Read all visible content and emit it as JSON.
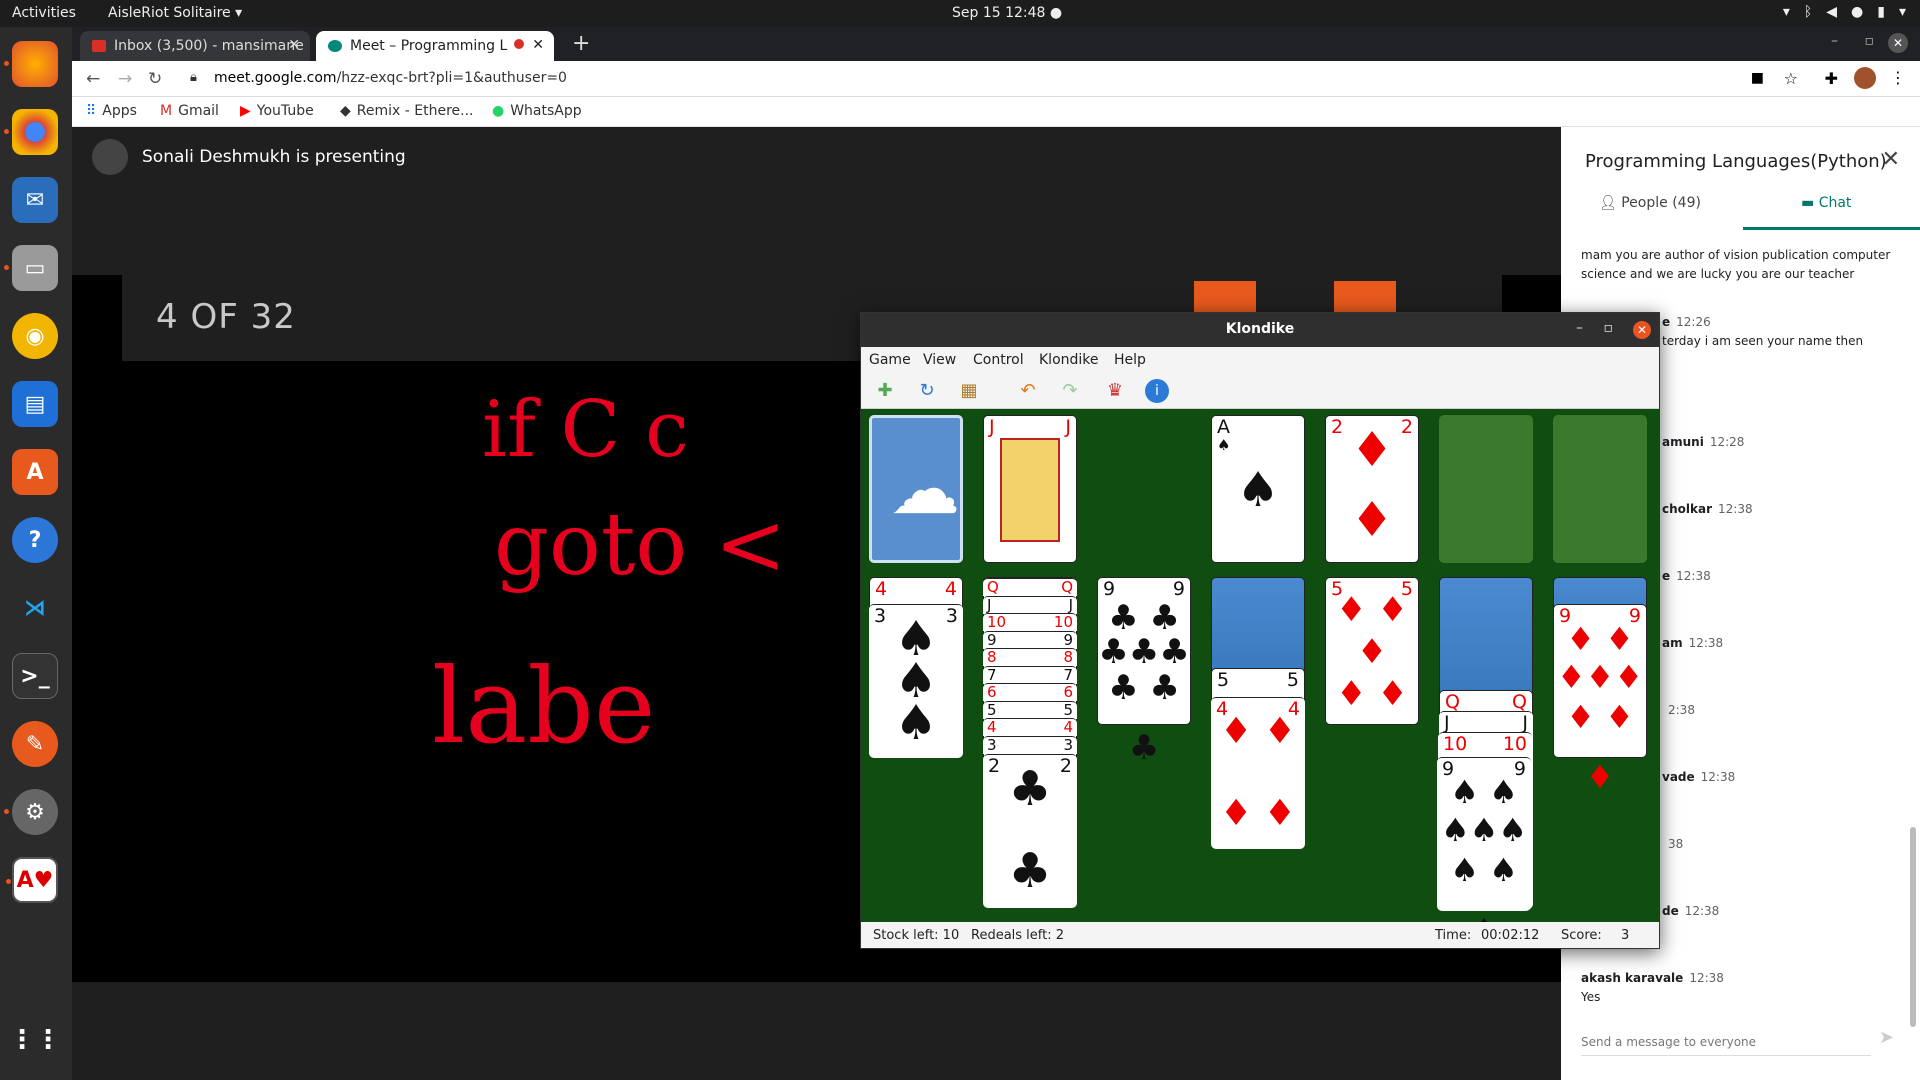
{
  "topbar": {
    "activities": "Activities",
    "app": "AisleRiot Solitaire ▾",
    "clock": "Sep 15  12:48  ●"
  },
  "tabs": [
    {
      "title": "Inbox (3,500) - mansimane",
      "close": "✕"
    },
    {
      "title": "Meet – Programming L",
      "close": "✕"
    }
  ],
  "new_tab": "+",
  "window_controls": [
    "–",
    "▫",
    "✕"
  ],
  "omnibox": {
    "url_host": "meet.google.com",
    "url_path": "/hzz-exqc-brt?pli=1&authuser=0",
    "back": "←",
    "forward": "→",
    "reload": "↻"
  },
  "bookmarks": [
    {
      "label": "Apps",
      "icon": "apps-grid-icon"
    },
    {
      "label": "Gmail",
      "icon": "gmail-icon"
    },
    {
      "label": "YouTube",
      "icon": "youtube-icon"
    },
    {
      "label": "Remix - Ethere...",
      "icon": "remix-icon"
    },
    {
      "label": "WhatsApp",
      "icon": "whatsapp-icon"
    }
  ],
  "meet": {
    "presenting": "Sonali Deshmukh is presenting",
    "slide_counter": "4 OF 32",
    "ink_lines": [
      "if  C  c",
      "goto  <",
      "labe"
    ]
  },
  "sidepanel": {
    "title": "Programming Languages(Python)",
    "tab_people": "People (49)",
    "tab_chat": "Chat",
    "messages": [
      {
        "sender": "",
        "time": "",
        "text": "mam you are author of vision publication computer science and  we are  lucky you are our teacher"
      },
      {
        "sender": "e",
        "time": "12:26",
        "text": "terday  i am seen your name then"
      },
      {
        "sender": "amuni",
        "time": "12:28",
        "text": ""
      },
      {
        "sender": "cholkar",
        "time": "12:38",
        "text": ""
      },
      {
        "sender": "e",
        "time": "12:38",
        "text": ""
      },
      {
        "sender": "am",
        "time": "12:38",
        "text": ""
      },
      {
        "sender": "",
        "time": "2:38",
        "text": ""
      },
      {
        "sender": "vade",
        "time": "12:38",
        "text": ""
      },
      {
        "sender": "",
        "time": "38",
        "text": ""
      },
      {
        "sender": "de",
        "time": "12:38",
        "text": ""
      },
      {
        "sender": "akash karavale",
        "time": "12:38",
        "text": "Yes"
      }
    ],
    "send_placeholder": "Send a message to everyone"
  },
  "klondike": {
    "title": "Klondike",
    "menu": [
      "Game",
      "View",
      "Control",
      "Klondike",
      "Help"
    ],
    "toolbar_icons": [
      "new-game-icon",
      "restart-icon",
      "select-game-icon",
      "undo-icon",
      "redo-icon",
      "hint-icon",
      "info-icon"
    ],
    "status": {
      "stock": "Stock left: 10",
      "redeals": "Redeals left: 2",
      "time_label": "Time:",
      "time": "00:02:12",
      "score_label": "Score:",
      "score": "3"
    },
    "cards": {
      "jack_hearts": {
        "rank": "J",
        "suit": "♥"
      },
      "ace_spades": {
        "rank": "A",
        "suit": "♠"
      },
      "two_diamonds": {
        "rank": "2",
        "suit": "♦"
      },
      "col1_top": {
        "rank": "4",
        "suit": "♥"
      },
      "col1_face": {
        "rank": "3",
        "suit": "♠"
      },
      "col2_face": {
        "rank": "2",
        "suit": "♣"
      },
      "col3_face": {
        "rank": "9",
        "suit": "♣"
      },
      "col4_mid": {
        "rank": "5",
        "suit": "♠"
      },
      "col4_face": {
        "rank": "4",
        "suit": "♦"
      },
      "col5_face": {
        "rank": "5",
        "suit": "♦"
      },
      "col6_q": {
        "rank": "Q",
        "suit": "♥"
      },
      "col6_j": {
        "rank": "J",
        "suit": "♠"
      },
      "col6_10": {
        "rank": "10",
        "suit": "♥"
      },
      "col6_face": {
        "rank": "9",
        "suit": "♠"
      },
      "col7_face": {
        "rank": "9",
        "suit": "♦"
      }
    },
    "col2_stack_ranks": [
      "Q",
      "J",
      "10",
      "9",
      "8",
      "7",
      "6",
      "5",
      "4",
      "3"
    ]
  }
}
